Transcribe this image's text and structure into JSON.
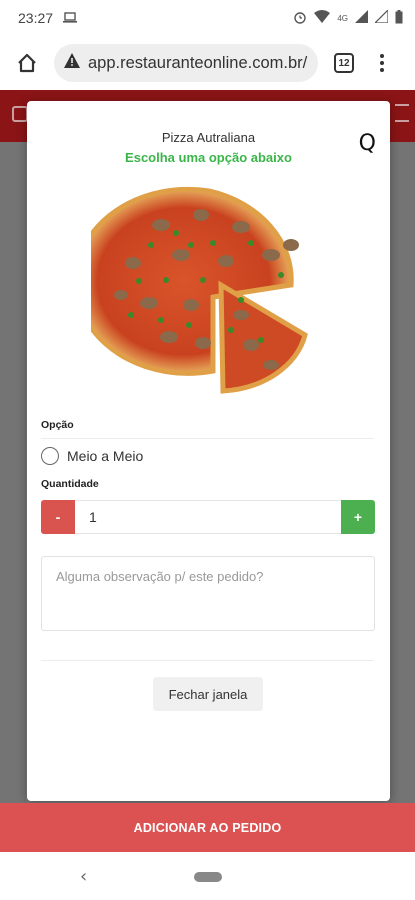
{
  "status_bar": {
    "time": "23:27",
    "network_label": "4G"
  },
  "browser": {
    "url": "app.restauranteonline.com.br/D",
    "tab_count": "12"
  },
  "modal": {
    "product_name": "Pizza Autraliana",
    "subtitle": "Escolha uma opção abaixo",
    "close_glyph": "Q",
    "option_label": "Opção",
    "options": [
      {
        "label": "Meio a Meio",
        "selected": false
      }
    ],
    "quantity_label": "Quantidade",
    "quantity_value": "1",
    "minus_label": "-",
    "plus_label": "+",
    "notes_placeholder": "Alguma observação p/ este pedido?",
    "close_button_label": "Fechar janela"
  },
  "footer": {
    "add_button_label": "ADICIONAR AO PEDIDO"
  },
  "nav": {
    "back_glyph": "‹"
  },
  "colors": {
    "header_red": "#8a1416",
    "accent_green": "#3bb54a",
    "minus_red": "#d9534f",
    "plus_green": "#4cb050",
    "add_button_red": "#dc5252"
  }
}
